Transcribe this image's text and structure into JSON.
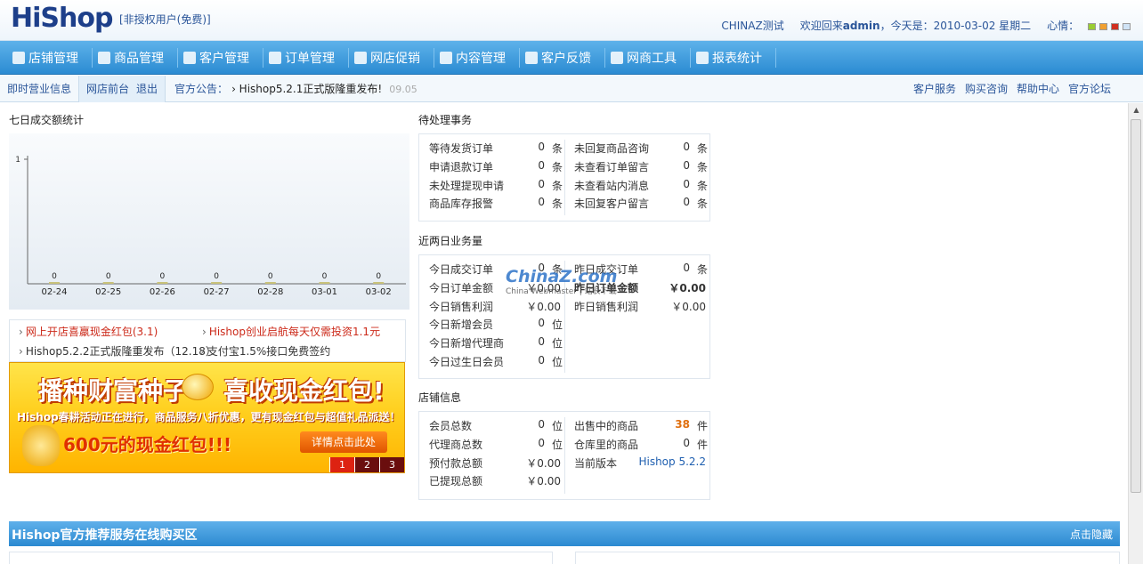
{
  "header": {
    "logo_text": "HiShop",
    "license_text": "[非授权用户(免费)]",
    "site_name": "CHINAZ测试",
    "welcome_prefix": "欢迎回来",
    "user": "admin",
    "today_text": "，今天是：2010-03-02 星期二",
    "mood_label": "心情：",
    "mood_colors": [
      "#9acd32",
      "#f0a030",
      "#d03020",
      "#cfe3f5"
    ]
  },
  "nav": {
    "items": [
      {
        "label": "店铺管理",
        "icon": "shop-icon"
      },
      {
        "label": "商品管理",
        "icon": "grid-icon"
      },
      {
        "label": "客户管理",
        "icon": "users-icon"
      },
      {
        "label": "订单管理",
        "icon": "order-icon"
      },
      {
        "label": "网店促销",
        "icon": "promo-icon"
      },
      {
        "label": "内容管理",
        "icon": "edit-icon"
      },
      {
        "label": "客户反馈",
        "icon": "feedback-icon"
      },
      {
        "label": "网商工具",
        "icon": "tools-icon"
      },
      {
        "label": "报表统计",
        "icon": "report-icon"
      }
    ]
  },
  "subbar": {
    "realtime": "即时营业信息",
    "front": "网店前台",
    "logout": "退出",
    "notice_label": "官方公告：",
    "notice_text": "› Hishop5.2.1正式版隆重发布!",
    "notice_date": "09.05",
    "right_links": [
      "客户服务",
      "购买咨询",
      "帮助中心",
      "官方论坛"
    ]
  },
  "chart": {
    "section_title": "七日成交额统计"
  },
  "chart_data": {
    "type": "bar",
    "title": "",
    "categories": [
      "02-24",
      "02-25",
      "02-26",
      "02-27",
      "02-28",
      "03-01",
      "03-02"
    ],
    "values": [
      0,
      0,
      0,
      0,
      0,
      0,
      0
    ],
    "ylim": [
      0,
      1
    ],
    "yticks": [
      1
    ]
  },
  "news": {
    "items": [
      {
        "text": "网上开店喜羸现金红包(3.1)",
        "color": "#cc2a1a"
      },
      {
        "text": "Hishop创业启航每天仅需投资1.1元",
        "color": "#cc2a1a"
      },
      {
        "text": "Hishop5.2.2正式版隆重发布（12.18）",
        "color": "#222222"
      },
      {
        "text": "支付宝1.5%接口免费签约",
        "color": "#222222"
      }
    ]
  },
  "banner": {
    "headline_a": "播种财富种子",
    "headline_b": "喜收现金红包!",
    "subline": "Hishop春耕活动正在进行，商品服务八折优惠，更有现金红包与超值礼品派送！",
    "amount_line": "600元的现金红包!!!",
    "cta": "详情点击此处",
    "pages": [
      "1",
      "2",
      "3"
    ]
  },
  "pending": {
    "title": "待处理事务",
    "left": [
      {
        "label": "等待发货订单",
        "value": "0",
        "unit": "条"
      },
      {
        "label": "申请退款订单",
        "value": "0",
        "unit": "条"
      },
      {
        "label": "未处理提现申请",
        "value": "0",
        "unit": "条"
      },
      {
        "label": "商品库存报警",
        "value": "0",
        "unit": "条"
      }
    ],
    "right": [
      {
        "label": "未回复商品咨询",
        "value": "0",
        "unit": "条"
      },
      {
        "label": "未查看订单留言",
        "value": "0",
        "unit": "条"
      },
      {
        "label": "未查看站内消息",
        "value": "0",
        "unit": "条"
      },
      {
        "label": "未回复客户留言",
        "value": "0",
        "unit": "条"
      }
    ]
  },
  "recent": {
    "title": "近两日业务量",
    "left": [
      {
        "label": "今日成交订单",
        "value": "0",
        "unit": "条"
      },
      {
        "label": "今日订单金额",
        "value": "￥0.00",
        "unit": ""
      },
      {
        "label": "今日销售利润",
        "value": "￥0.00",
        "unit": ""
      },
      {
        "label": "今日新增会员",
        "value": "0",
        "unit": "位"
      },
      {
        "label": "今日新增代理商",
        "value": "0",
        "unit": "位"
      },
      {
        "label": "今日过生日会员",
        "value": "0",
        "unit": "位"
      }
    ],
    "right": [
      {
        "label": "昨日成交订单",
        "value": "0",
        "unit": "条"
      },
      {
        "label": "昨日订单金额",
        "value": "￥0.00",
        "unit": ""
      },
      {
        "label": "昨日销售利润",
        "value": "￥0.00",
        "unit": ""
      }
    ]
  },
  "shop": {
    "title": "店铺信息",
    "left": [
      {
        "label": "会员总数",
        "value": "0",
        "unit": "位"
      },
      {
        "label": "代理商总数",
        "value": "0",
        "unit": "位"
      },
      {
        "label": "预付款总额",
        "value": "￥0.00",
        "unit": ""
      },
      {
        "label": "已提现总额",
        "value": "￥0.00",
        "unit": ""
      }
    ],
    "right": [
      {
        "label": "出售中的商品",
        "value": "38",
        "unit": "件"
      },
      {
        "label": "仓库里的商品",
        "value": "0",
        "unit": "件"
      },
      {
        "label": "当前版本",
        "value": "Hishop 5.2.2",
        "unit": ""
      }
    ]
  },
  "watermark": {
    "brand": "ChinaZ.com",
    "tagline": "China Webmaster | 站长下载"
  },
  "recommend": {
    "title": "Hishop官方推荐服务在线购买区",
    "hide": "点击隐藏"
  }
}
